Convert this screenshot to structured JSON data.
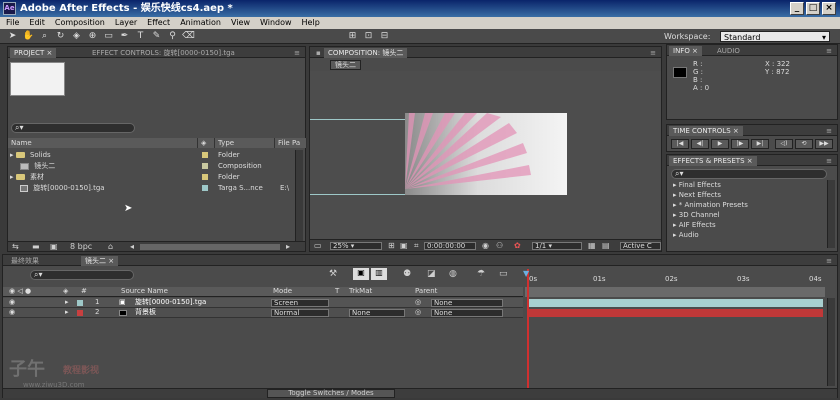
{
  "titlebar": {
    "title": "Adobe After Effects - 娱乐快线cs4.aep *",
    "logo": "Ae",
    "min": "_",
    "max": "□",
    "close": "×"
  },
  "menu": [
    "File",
    "Edit",
    "Composition",
    "Layer",
    "Effect",
    "Animation",
    "View",
    "Window",
    "Help"
  ],
  "toolbar": {
    "workspace_label": "Workspace:",
    "workspace_value": "Standard"
  },
  "project": {
    "tabs": [
      "PROJECT ×",
      "EFFECT CONTROLS: 旋转[0000-0150].tga"
    ],
    "columns": [
      "Name",
      "Type",
      "File Pa"
    ],
    "items": [
      {
        "name": "Solids",
        "type": "Folder",
        "kind": "folder",
        "color": "#d8c77a"
      },
      {
        "name": "镜头二",
        "type": "Composition",
        "kind": "comp",
        "color": "#c8c8a0"
      },
      {
        "name": "素材",
        "type": "Folder",
        "kind": "folder",
        "color": "#d8c77a"
      },
      {
        "name": "旋转[0000-0150].tga",
        "type": "Targa S...nce",
        "kind": "footage",
        "color": "#9ec8c8",
        "path": "E:\\"
      }
    ],
    "bpc": "8 bpc"
  },
  "composition": {
    "tab": "COMPOSITION: 镜头二",
    "comp_tab": "镜头二",
    "zoom": "25%",
    "timecode": "0:00:00:00",
    "resolution": "1/1",
    "camera": "Active C"
  },
  "info": {
    "tabs": [
      "INFO ×",
      "AUDIO"
    ],
    "r": "R :",
    "g": "G :",
    "b": "B :",
    "a": "A : 0",
    "x": "X : 322",
    "y": "Y : 872"
  },
  "time_controls": {
    "tab": "TIME CONTROLS ×"
  },
  "effects_presets": {
    "tab": "EFFECTS & PRESETS ×",
    "items": [
      "Final Effects",
      "Next Effects",
      "* Animation Presets",
      "3D Channel",
      "AIF Effects",
      "Audio"
    ]
  },
  "timeline": {
    "tabs": [
      "最终效果",
      "镜头二 ×"
    ],
    "columns": [
      "#",
      "Source Name",
      "Mode",
      "T",
      "TrkMat",
      "Parent"
    ],
    "ruler": [
      "0s",
      "01s",
      "02s",
      "03s",
      "04s"
    ],
    "layers": [
      {
        "num": "1",
        "name": "旋转[0000-0150].tga",
        "mode": "Screen",
        "trkmat": "",
        "parent": "None",
        "label_color": "#9ec8c8",
        "bar_color": "#a8cfcf"
      },
      {
        "num": "2",
        "name": "背景板",
        "mode": "Normal",
        "trkmat": "None",
        "parent": "None",
        "label_color": "#c84040",
        "bar_color": "#c03838"
      }
    ],
    "toggle": "Toggle Switches / Modes"
  },
  "watermark": {
    "logo": "子午",
    "sub": "教程影视",
    "url": "www.ziwu3D.com"
  }
}
